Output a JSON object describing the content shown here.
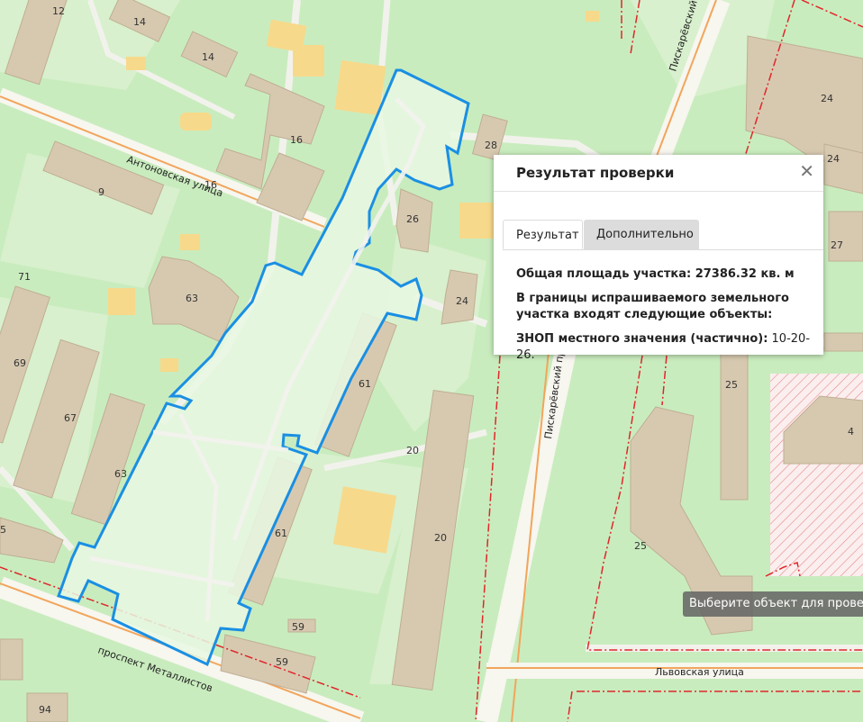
{
  "colors": {
    "park": "#c9ecbe",
    "lawn": "#d8f0cd",
    "building": "#d7c9b0",
    "yard": "#f7d98b",
    "road": "#f7f6ef",
    "highway": "#f2a55b",
    "parcel_outline": "#1a8fe3",
    "parcel_fill": "#e9f8e3",
    "zone_line": "#e0262a"
  },
  "popup": {
    "title": "Результат проверки",
    "close_icon": "close-icon",
    "tabs": [
      {
        "label": "Результат",
        "active": true
      },
      {
        "label": "Дополнительно",
        "active": false
      }
    ],
    "area_text": "Общая площадь участка: 27386.32 кв. м",
    "boundaries_text": "В границы испрашиваемого земельного участка входят следующие объекты:",
    "zone_label": "ЗНОП местного значения (частично):",
    "zone_value": " 10-20-26."
  },
  "tooltip": "Выберите объект для проверки",
  "map": {
    "streets": {
      "antonovskaya": "Антоновская улица",
      "metallistov": "проспект Металлистов",
      "lvovskaya": "Львовская улица",
      "piskarevsky_top": "Пискарёвский пр",
      "piskarevsky_mid": "Пискарёвский пр"
    },
    "house_numbers": {
      "h12": "12",
      "h14a": "14",
      "h14b": "14",
      "h16a": "16",
      "h16b": "16",
      "h9": "9",
      "h71": "71",
      "h63a": "63",
      "h63b": "63",
      "h69": "69",
      "h67": "67",
      "h5": "5",
      "h26": "26",
      "h28": "28",
      "h24a": "24",
      "h61a": "61",
      "h61b": "61",
      "h20a": "20",
      "h20b": "20",
      "h59a": "59",
      "h59b": "59",
      "h94": "94",
      "h24b": "24",
      "h24c": "24",
      "h27": "27",
      "h25a": "25",
      "h25b": "25",
      "h4": "4"
    }
  }
}
